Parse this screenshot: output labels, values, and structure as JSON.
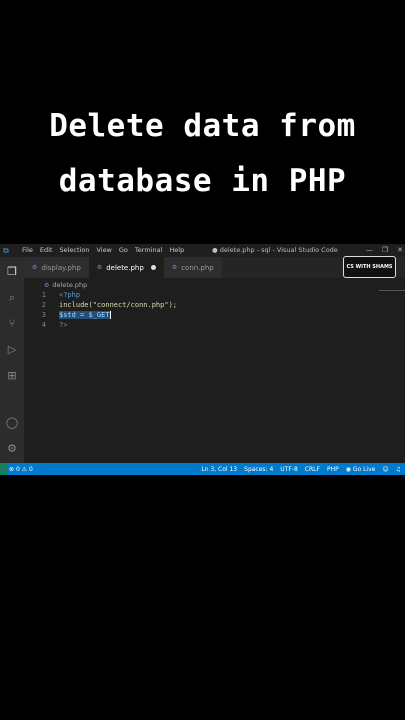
{
  "headline": {
    "line1": "Delete data from",
    "line2": "database in PHP"
  },
  "window": {
    "title": "● delete.php - sql - Visual Studio Code",
    "menu": [
      "File",
      "Edit",
      "Selection",
      "View",
      "Go",
      "Terminal",
      "Help"
    ],
    "controls": {
      "minimize": "—",
      "restore": "❐",
      "close": "✕"
    }
  },
  "activity_bar": {
    "items": [
      "explorer-icon",
      "search-icon",
      "source-control-icon",
      "run-debug-icon",
      "extensions-icon",
      "account-icon",
      "settings-icon"
    ]
  },
  "tabs": [
    {
      "label": "display.php",
      "icon": "php-file-icon",
      "active": false,
      "modified": false
    },
    {
      "label": "delete.php",
      "icon": "php-file-icon",
      "active": true,
      "modified": true
    },
    {
      "label": "conn.php",
      "icon": "php-file-icon",
      "active": false,
      "modified": false
    }
  ],
  "breadcrumb": {
    "file": "delete.php"
  },
  "editor": {
    "lines": [
      {
        "number": "1",
        "text": "<?php"
      },
      {
        "number": "2",
        "text": "include(\"connect/conn.php\");"
      },
      {
        "number": "3",
        "text": "$std = $_GET"
      },
      {
        "number": "4",
        "text": "?>"
      }
    ]
  },
  "watermark": {
    "text": "CS WITH SHAMS"
  },
  "statusbar": {
    "errors": "0",
    "warnings": "0",
    "position": "Ln 3, Col 13",
    "indent": "Spaces: 4",
    "encoding": "UTF-8",
    "eol": "CRLF",
    "language": "PHP",
    "golive": "Go Live"
  },
  "colors": {
    "status_bar": "#007acc",
    "editor_bg": "#1e1e1e",
    "php_icon": "#a074c4"
  }
}
